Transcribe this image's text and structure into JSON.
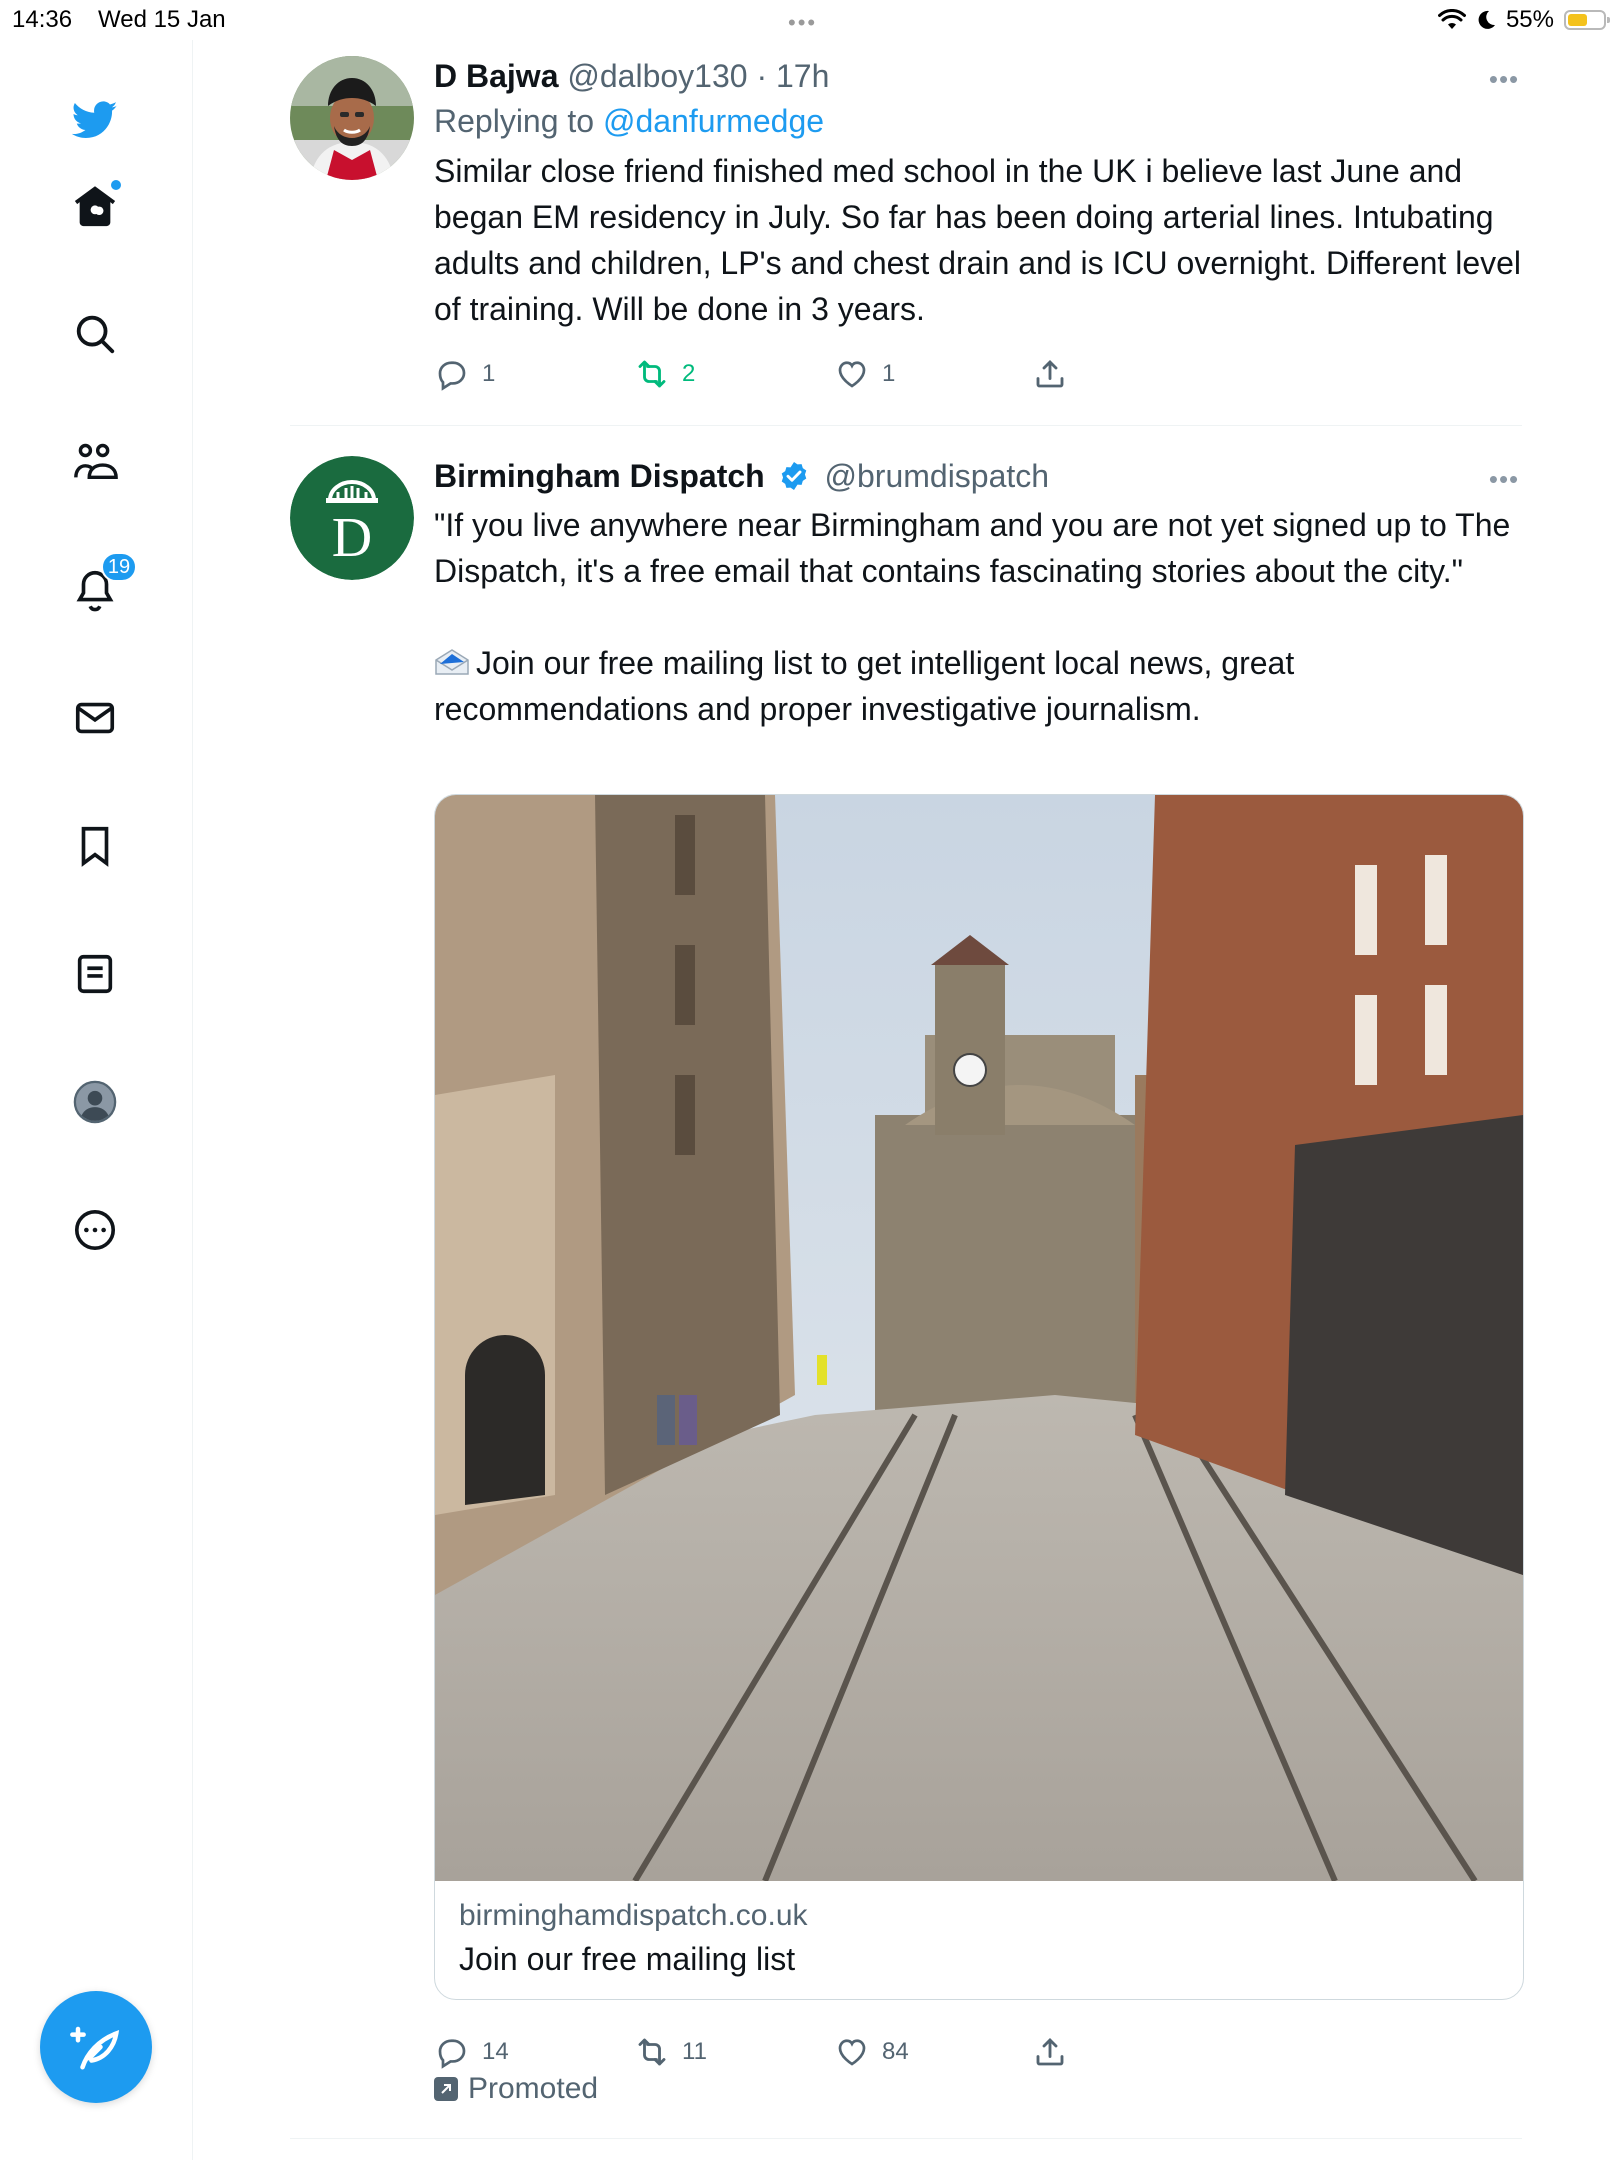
{
  "status_bar": {
    "time": "14:36",
    "date": "Wed 15 Jan",
    "battery": "55%",
    "battery_level": 0.55
  },
  "sidebar": {
    "icons": [
      "twitter-logo-icon",
      "home-icon",
      "search-icon",
      "communities-icon",
      "notifications-icon",
      "messages-icon",
      "bookmarks-icon",
      "lists-icon",
      "profile-icon",
      "more-icon"
    ],
    "notifications_badge": "19"
  },
  "tweets": [
    {
      "name": "D Bajwa",
      "handle": "@dalboy130",
      "separator": "·",
      "time": "17h",
      "replying_label": "Replying to",
      "replying_to": "@danfurmedge",
      "text": "Similar close friend finished med school in the UK i believe last June and began EM residency in July. So far has been doing arterial lines. Intubating adults and children, LP's and chest drain and is ICU overnight. Different level of training. Will be done in 3 years.",
      "replies": "1",
      "retweets": "2",
      "likes": "1"
    },
    {
      "name": "Birmingham Dispatch",
      "handle": "@brumdispatch",
      "avatar_letter": "D",
      "text_1": "\"If you live anywhere near Birmingham and you are not yet signed up to The Dispatch, it's a free email that contains fascinating stories about the city.\"",
      "text_2": "Join our free mailing list to get intelligent local news, great recommendations and proper investigative journalism.",
      "card_domain": "birminghamdispatch.co.uk",
      "card_title": "Join our free mailing list",
      "replies": "14",
      "retweets": "11",
      "likes": "84",
      "promoted": "Promoted"
    }
  ],
  "colors": {
    "accent": "#1d9bf0",
    "retweet_green": "#00ba7c",
    "secondary_text": "#536471",
    "dispatch_green": "#1a6b3f"
  }
}
